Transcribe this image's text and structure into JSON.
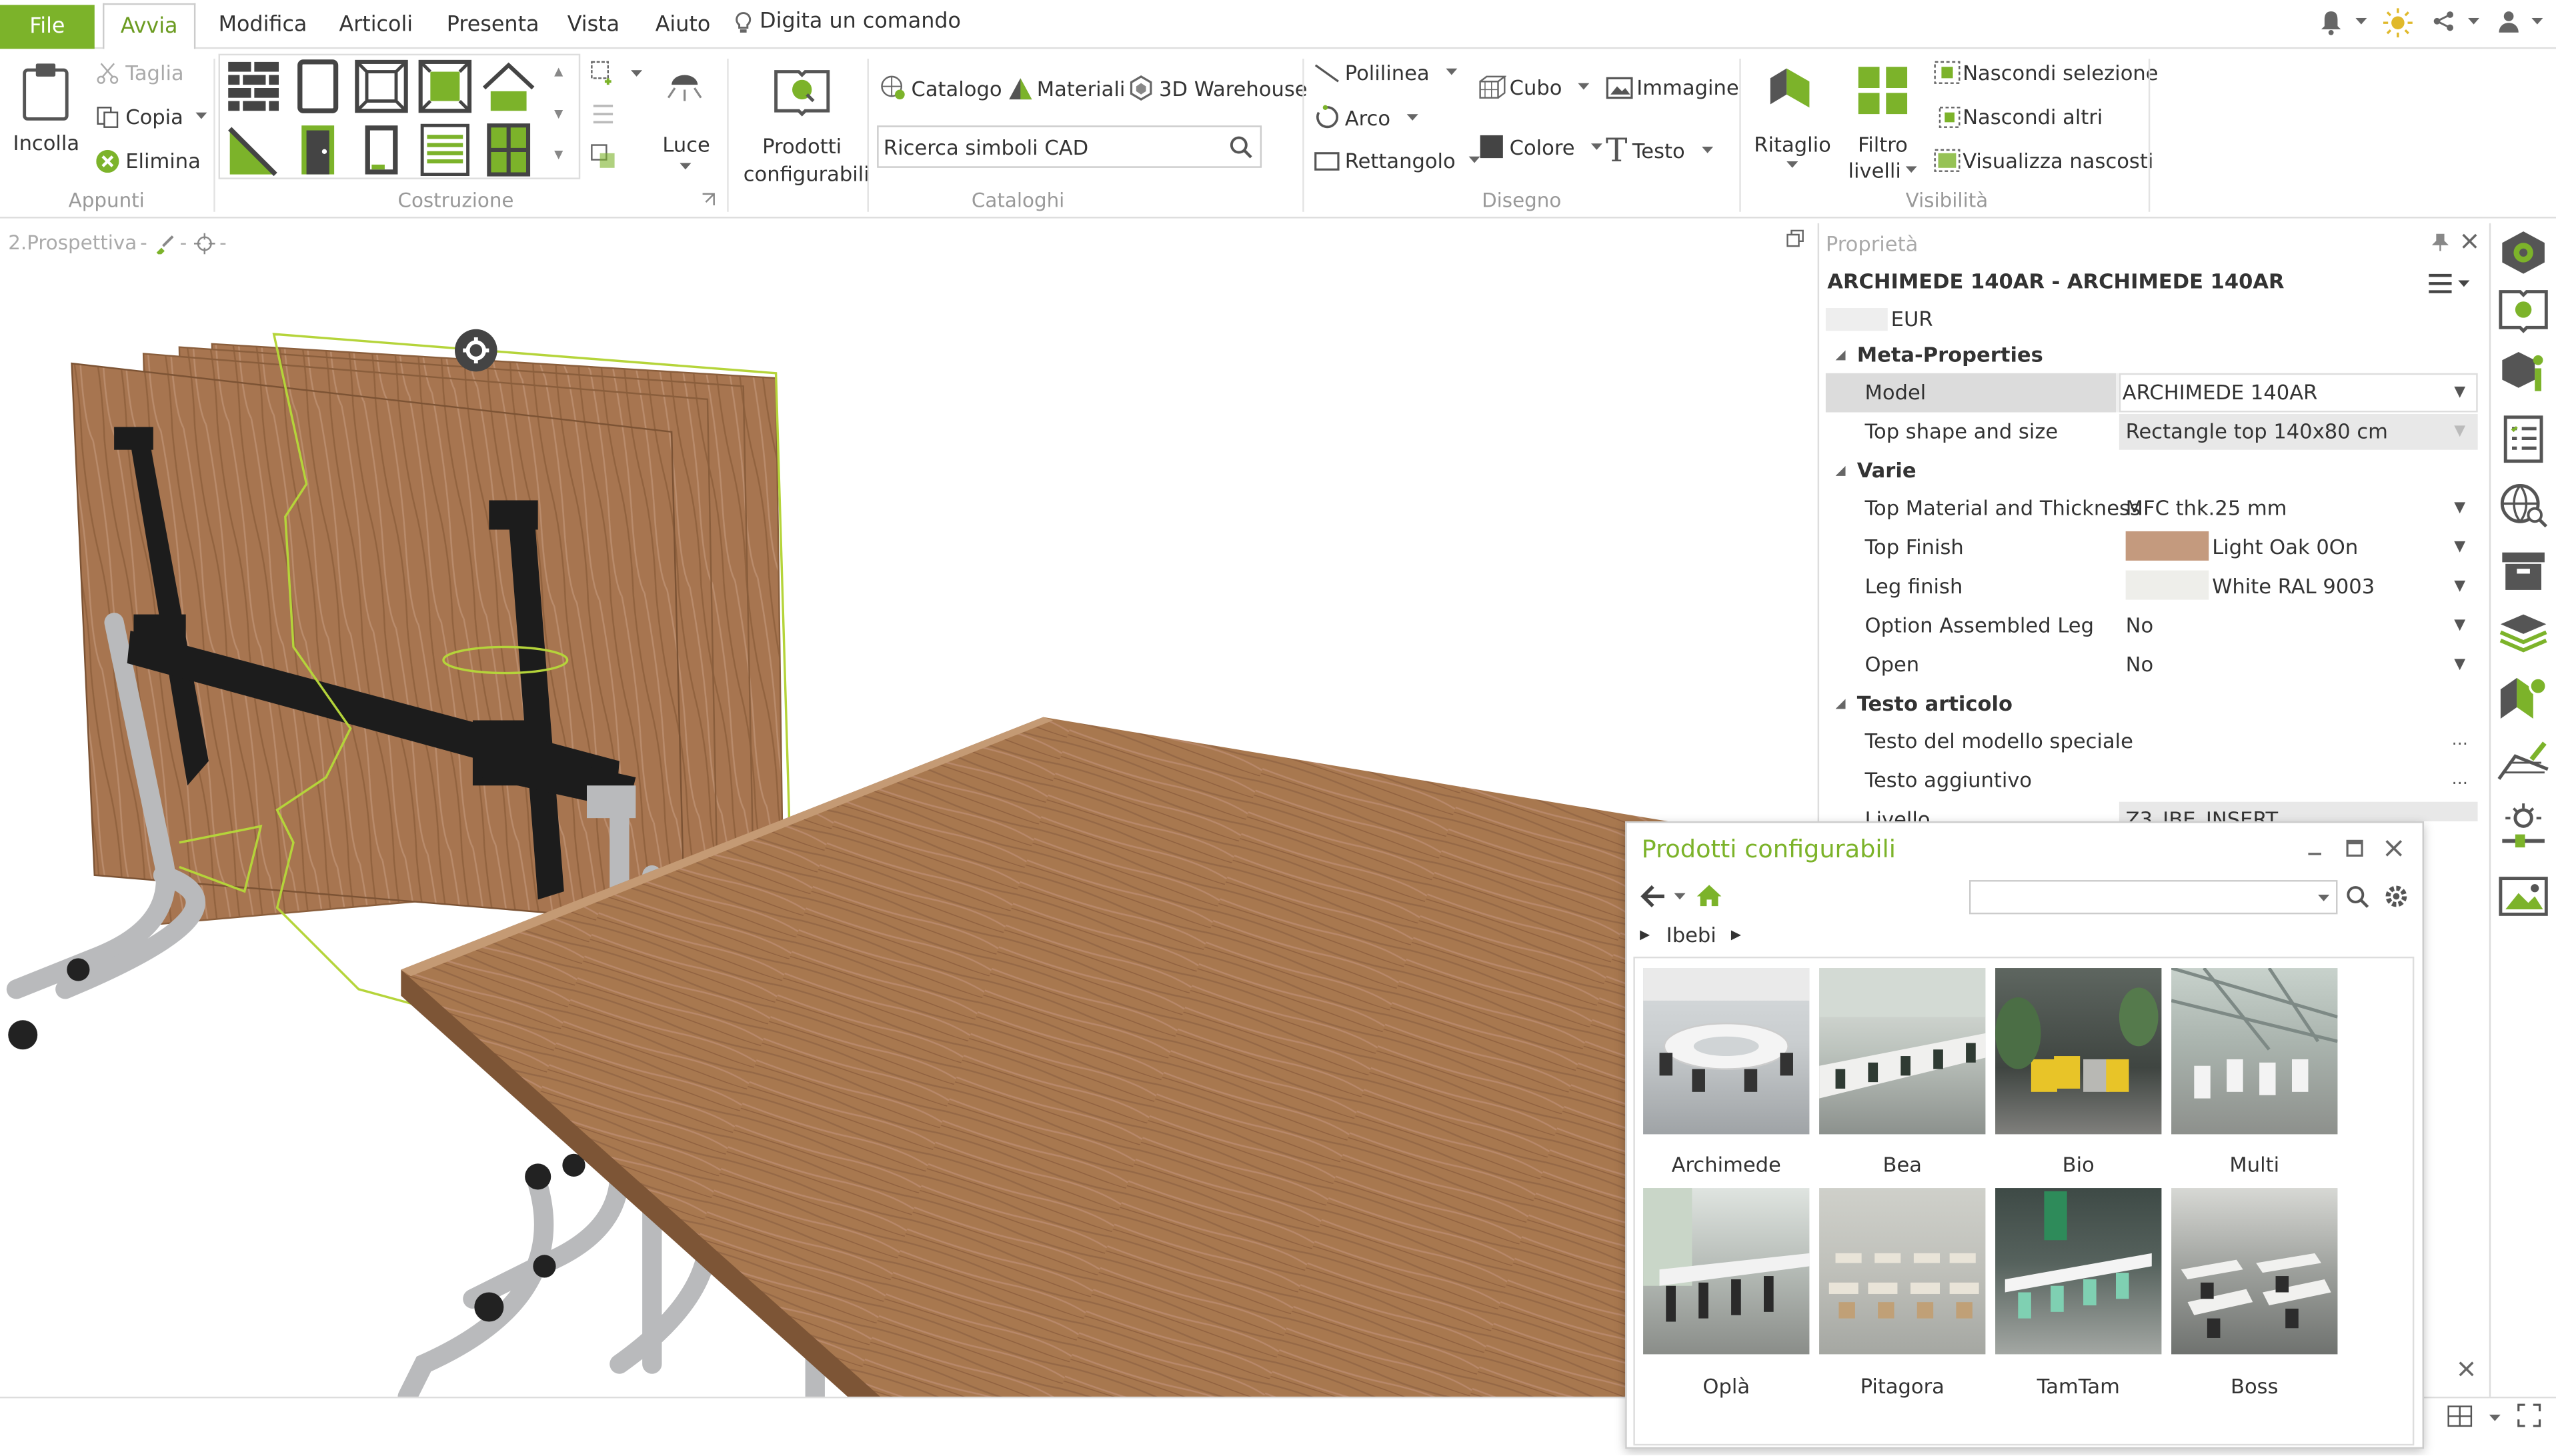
{
  "menubar": {
    "file": "File",
    "items": [
      "Avvia",
      "Modifica",
      "Articoli",
      "Presenta",
      "Vista",
      "Aiuto"
    ],
    "command_hint": "Digita un comando"
  },
  "ribbon": {
    "appunti": {
      "label": "Appunti",
      "incolla": "Incolla",
      "taglia": "Taglia",
      "copia": "Copia",
      "elimina": "Elimina"
    },
    "costruzione": {
      "label": "Costruzione",
      "luce": "Luce",
      "prodotti": "Prodotti",
      "configurabili": "configurabili"
    },
    "cataloghi": {
      "label": "Cataloghi",
      "catalogo": "Catalogo",
      "materiali": "Materiali",
      "warehouse": "3D Warehouse",
      "search_value": "Ricerca simboli CAD"
    },
    "disegno": {
      "label": "Disegno",
      "polilinea": "Polilinea",
      "arco": "Arco",
      "rettangolo": "Rettangolo",
      "cubo": "Cubo",
      "immagine": "Immagine",
      "colore": "Colore",
      "testo": "Testo"
    },
    "visibilita": {
      "label": "Visibilità",
      "ritaglio": "Ritaglio",
      "filtro": "Filtro",
      "livelli": "livelli",
      "nascondi_sel": "Nascondi selezione",
      "nascondi_altri": "Nascondi altri",
      "visualizza": "Visualizza nascosti"
    }
  },
  "viewport": {
    "tab": "2.Prospettiva"
  },
  "properties": {
    "header": "Proprietà",
    "title": "ARCHIMEDE 140AR - ARCHIMEDE 140AR",
    "currency": "EUR",
    "sections": {
      "meta": "Meta-Properties",
      "varie": "Varie",
      "testo": "Testo articolo"
    },
    "rows": {
      "model": {
        "k": "Model",
        "v": "ARCHIMEDE 140AR"
      },
      "top_shape": {
        "k": "Top shape and size",
        "v": "Rectangle top 140x80 cm"
      },
      "top_material": {
        "k": "Top Material and Thickness",
        "v": "MFC thk.25 mm"
      },
      "top_finish": {
        "k": "Top Finish",
        "v": "Light Oak 0On"
      },
      "leg_finish": {
        "k": "Leg finish",
        "v": "White RAL 9003"
      },
      "assembled": {
        "k": "Option Assembled Leg",
        "v": "No"
      },
      "open": {
        "k": "Open",
        "v": "No"
      },
      "speciale": {
        "k": "Testo del modello speciale",
        "v": ""
      },
      "aggiuntivo": {
        "k": "Testo aggiuntivo",
        "v": ""
      },
      "livello": {
        "k": "Livello",
        "v": "Z3_IBE_INSERT"
      }
    }
  },
  "configurator": {
    "title": "Prodotti configurabili",
    "breadcrumb": "Ibebi",
    "products": [
      "Archimede",
      "Bea",
      "Bio",
      "Multi",
      "Oplà",
      "Pitagora",
      "TamTam",
      "Boss"
    ]
  },
  "colors": {
    "accent": "#7cb32a",
    "wood": "#a8784f",
    "oak_swatch": "#c49a7e",
    "frame": "#1c1c1c"
  }
}
